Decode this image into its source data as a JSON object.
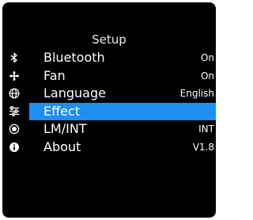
{
  "title": "Setup",
  "colors": {
    "screen_background": "#000000",
    "text": "#ffffff",
    "selection": "#1e8ef0"
  },
  "menu": {
    "selected_index": 3,
    "items": [
      {
        "icon": "bluetooth-icon",
        "label": "Bluetooth",
        "value": "On"
      },
      {
        "icon": "fan-icon",
        "label": "Fan",
        "value": "On"
      },
      {
        "icon": "globe-icon",
        "label": "Language",
        "value": "English"
      },
      {
        "icon": "equalizer-icon",
        "label": "Effect",
        "value": ""
      },
      {
        "icon": "target-icon",
        "label": "LM/INT",
        "value": "INT"
      },
      {
        "icon": "info-icon",
        "label": "About",
        "value": "V1.8"
      }
    ]
  }
}
